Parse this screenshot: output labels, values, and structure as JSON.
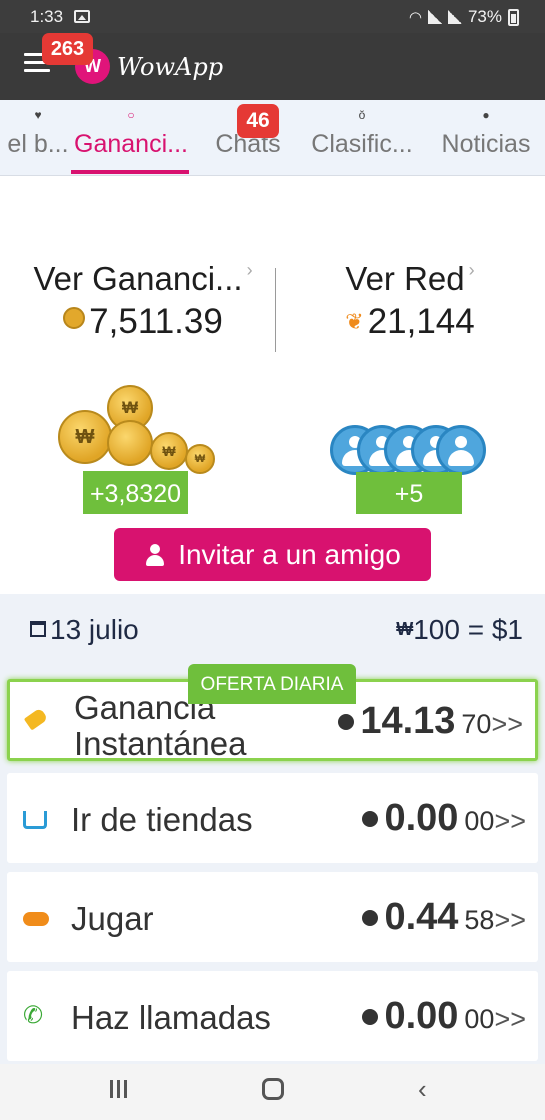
{
  "status_bar": {
    "time": "1:33",
    "battery": "73%"
  },
  "app_bar": {
    "app_name": "WowApp",
    "menu_badge": "263",
    "logo_glyph": "W"
  },
  "tabs": [
    {
      "label": "el b...",
      "icon": "heart-icon",
      "active": false
    },
    {
      "label": "Gananci...",
      "icon": "dot-icon",
      "active": true
    },
    {
      "label": "Chats",
      "icon": "chat-icon",
      "active": false,
      "badge": "46"
    },
    {
      "label": "Clasific...",
      "icon": "medal-icon",
      "active": false
    },
    {
      "label": "Noticias",
      "icon": "globe-icon",
      "active": false
    }
  ],
  "summary": {
    "earnings_title": "Ver Gananci...",
    "earnings_value": "7,511.39",
    "network_title": "Ver Red",
    "network_value": "21,144",
    "coin_glyph": "₩",
    "earnings_delta": "+3,8320",
    "network_delta": "+5"
  },
  "invite_button": {
    "label": "Invitar a un amigo"
  },
  "offers": {
    "date": "13 julio",
    "rate": "100 = $1",
    "rate_icon": "₩",
    "daily_badge": "OFERTA DIARIA",
    "items": [
      {
        "label_line1": "Ganancia",
        "label_line2": "Instantánea",
        "amount_main": "14.13",
        "amount_sub": "70",
        "arrow": ">>",
        "icon": "tag-icon"
      },
      {
        "label": "Ir de tiendas",
        "amount_main": "0.00",
        "amount_sub": "00",
        "arrow": ">>",
        "icon": "cart-icon"
      },
      {
        "label": "Jugar",
        "amount_main": "0.44",
        "amount_sub": "58",
        "arrow": ">>",
        "icon": "gamepad-icon"
      },
      {
        "label": "Haz llamadas",
        "amount_main": "0.00",
        "amount_sub": "00",
        "arrow": ">>",
        "icon": "phone-icon"
      }
    ]
  },
  "colors": {
    "brand_pink": "#d8126f",
    "accent_green": "#6fbf3c",
    "app_bar": "#3a3a3a"
  }
}
